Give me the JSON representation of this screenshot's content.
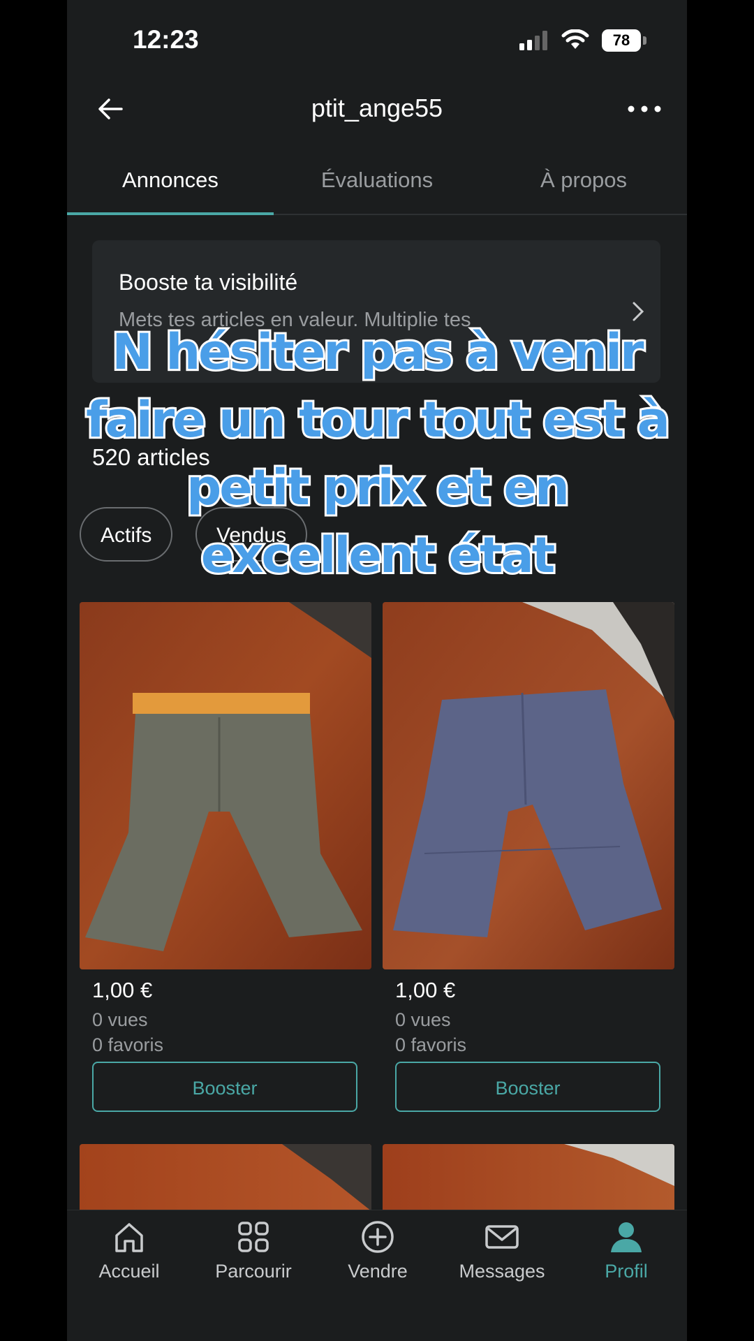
{
  "status": {
    "time": "12:23",
    "battery": "78"
  },
  "header": {
    "title": "ptit_ange55"
  },
  "tabs": [
    {
      "label": "Annonces",
      "active": true
    },
    {
      "label": "Évaluations",
      "active": false
    },
    {
      "label": "À propos",
      "active": false
    }
  ],
  "boost": {
    "title": "Booste ta visibilité",
    "subtitle": "Mets tes articles en valeur. Multiplie tes"
  },
  "listing": {
    "count": "520 articles",
    "filters": [
      {
        "label": "Actifs"
      },
      {
        "label": "Vendus"
      }
    ]
  },
  "products": [
    {
      "price": "1,00 €",
      "views": "0 vues",
      "favorites": "0 favoris",
      "button": "Booster",
      "color": "#6b6d61"
    },
    {
      "price": "1,00 €",
      "views": "0 vues",
      "favorites": "0 favoris",
      "button": "Booster",
      "color": "#5c6488"
    }
  ],
  "overlay_caption": [
    "N hésiter pas à venir",
    "faire un tour tout est à",
    "petit prix et en",
    "excellent état"
  ],
  "nav": [
    {
      "label": "Accueil",
      "icon": "home-icon"
    },
    {
      "label": "Parcourir",
      "icon": "grid-icon"
    },
    {
      "label": "Vendre",
      "icon": "plus-circle-icon"
    },
    {
      "label": "Messages",
      "icon": "mail-icon"
    },
    {
      "label": "Profil",
      "icon": "profile-icon",
      "active": true
    }
  ],
  "colors": {
    "accent": "#4aa8a6",
    "background": "#1b1d1e",
    "caption": "#4a9ee8"
  }
}
